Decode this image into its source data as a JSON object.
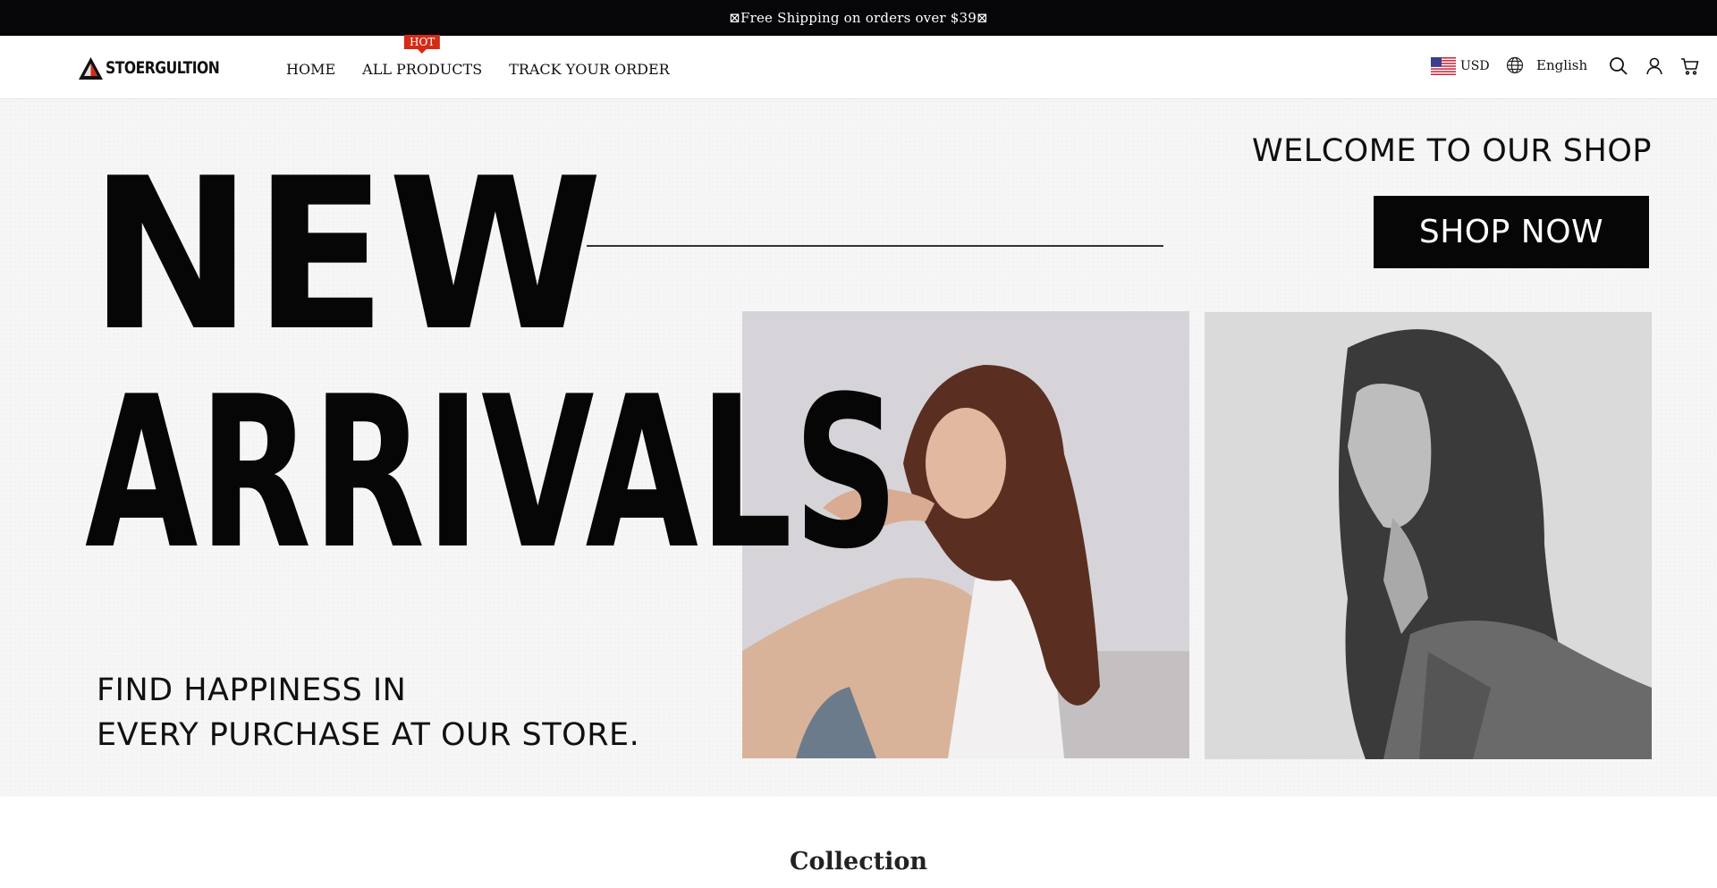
{
  "announcement": {
    "text": "⊠Free Shipping on orders over $39⊠"
  },
  "header": {
    "logo_text": "STOERGULTION",
    "nav": [
      {
        "label": "HOME"
      },
      {
        "label": "ALL PRODUCTS",
        "badge": "HOT"
      },
      {
        "label": "TRACK YOUR ORDER"
      }
    ],
    "currency": "USD",
    "language": "English",
    "icons": [
      "search-icon",
      "account-icon",
      "cart-icon"
    ]
  },
  "hero": {
    "headline_line1": "NEW",
    "headline_line2": "ARRIVALS",
    "welcome": "WELCOME TO OUR SHOP",
    "cta_label": "SHOP NOW",
    "tagline_line1": "FIND HAPPINESS IN",
    "tagline_line2": "EVERY PURCHASE AT OUR STORE."
  },
  "collection": {
    "title": "Collection"
  },
  "colors": {
    "announcement_bg": "#060507",
    "hot_badge": "#d32c16",
    "button_bg": "#060606",
    "hero_bg": "#f6f6f6"
  }
}
